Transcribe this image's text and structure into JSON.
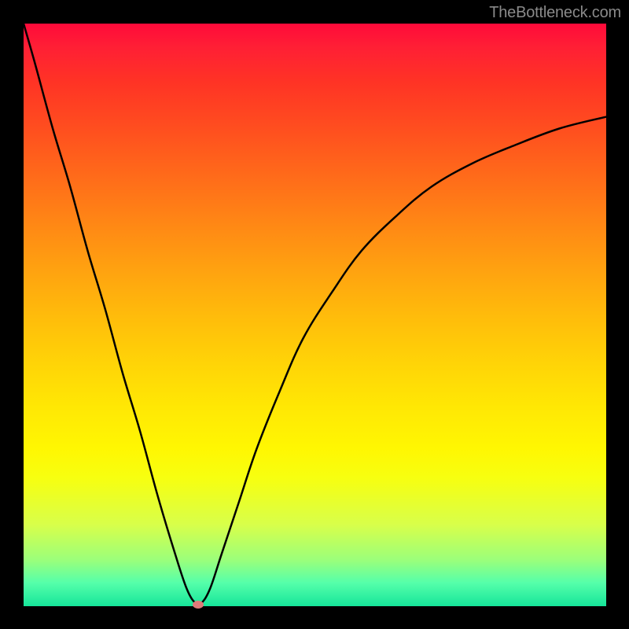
{
  "watermark": "TheBottleneck.com",
  "colors": {
    "frame": "#000000",
    "curve": "#000000",
    "marker": "#e07a7a",
    "gradient_top": "#ff0a3a",
    "gradient_bottom": "#16e59a"
  },
  "chart_data": {
    "type": "line",
    "title": "",
    "xlabel": "",
    "ylabel": "",
    "xlim": [
      0,
      100
    ],
    "ylim": [
      0,
      100
    ],
    "series": [
      {
        "name": "bottleneck-curve",
        "x": [
          0,
          2,
          5,
          8,
          11,
          14,
          17,
          20,
          23,
          26,
          28,
          29.5,
          30.5,
          32,
          34,
          37,
          40,
          44,
          48,
          53,
          58,
          64,
          70,
          77,
          84,
          92,
          100
        ],
        "values": [
          100,
          93,
          82,
          72,
          61,
          51,
          40,
          30,
          19,
          9,
          3,
          0.5,
          0.5,
          3,
          9,
          18,
          27,
          37,
          46,
          54,
          61,
          67,
          72,
          76,
          79,
          82,
          84
        ]
      }
    ],
    "annotations": [
      {
        "name": "min-marker",
        "x": 30,
        "y": 0.3
      }
    ],
    "background_gradient": {
      "direction": "vertical",
      "meaning": "bottleneck severity (red=high, green=low)"
    }
  }
}
